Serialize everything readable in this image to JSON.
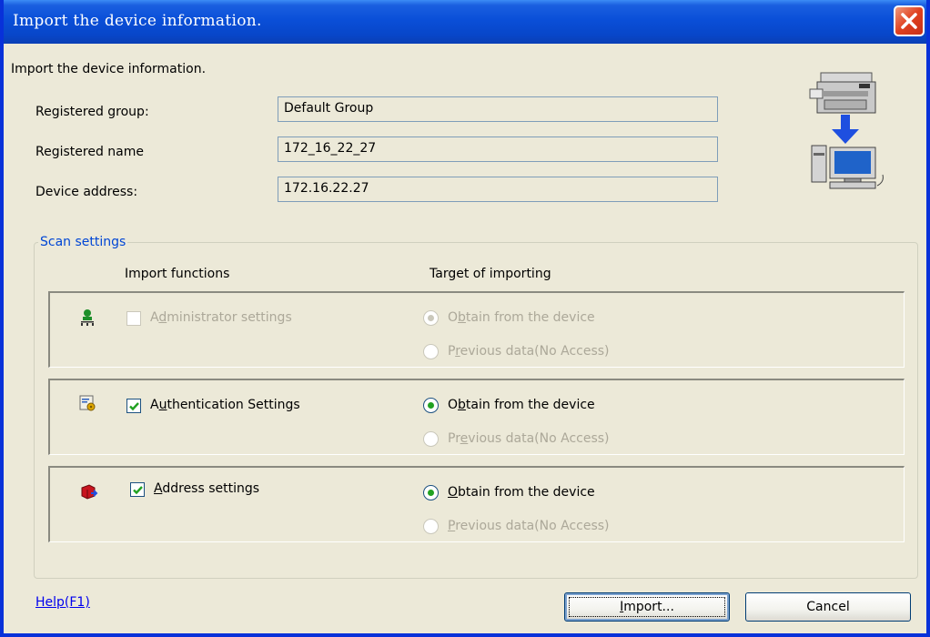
{
  "window": {
    "title": "Import the device information."
  },
  "intro_text": "Import the device information.",
  "fields": {
    "registered_group_label": "Registered group:",
    "registered_group_value": "Default Group",
    "registered_name_label": "Registered name",
    "registered_name_value": "172_16_22_27",
    "device_address_label": "Device address:",
    "device_address_value": "172.16.22.27"
  },
  "scan_settings": {
    "legend": "Scan settings",
    "col_import_functions": "Import functions",
    "col_target_of_importing": "Target of importing",
    "sections": [
      {
        "icon": "administrator-icon",
        "checkbox_label_pre": "A",
        "checkbox_label_accel": "d",
        "checkbox_label_post": "ministrator settings",
        "checked": false,
        "enabled": false,
        "option1_pre": "O",
        "option1_accel": "b",
        "option1_post": "tain from the device",
        "option2_pre": "P",
        "option2_accel": "r",
        "option2_post": "evious data(No Access)",
        "selected": "option1"
      },
      {
        "icon": "authentication-icon",
        "checkbox_label_pre": "A",
        "checkbox_label_accel": "u",
        "checkbox_label_post": "thentication Settings",
        "checked": true,
        "enabled": true,
        "option1_pre": "O",
        "option1_accel": "b",
        "option1_post": "tain from the device",
        "option2_pre": "Pr",
        "option2_accel": "e",
        "option2_post": "vious data(No Access)",
        "selected": "option1"
      },
      {
        "icon": "address-book-icon",
        "checkbox_label_pre": "",
        "checkbox_label_accel": "A",
        "checkbox_label_post": "ddress settings",
        "checked": true,
        "enabled": true,
        "option1_pre": "",
        "option1_accel": "O",
        "option1_post": "btain from the device",
        "option2_pre": "",
        "option2_accel": "P",
        "option2_post": "revious data(No Access)",
        "selected": "option1"
      }
    ]
  },
  "footer": {
    "help_pre": "Hel",
    "help_accel": "p",
    "help_post": "(F1)",
    "import_accel": "I",
    "import_post": "mport...",
    "cancel_label": "Cancel"
  },
  "colors": {
    "title_bar": "#0a4fd8",
    "dialog_bg": "#ece9d8",
    "legend_text": "#0046d5",
    "radio_dot": "#21a121",
    "disabled_text": "#aca899"
  }
}
